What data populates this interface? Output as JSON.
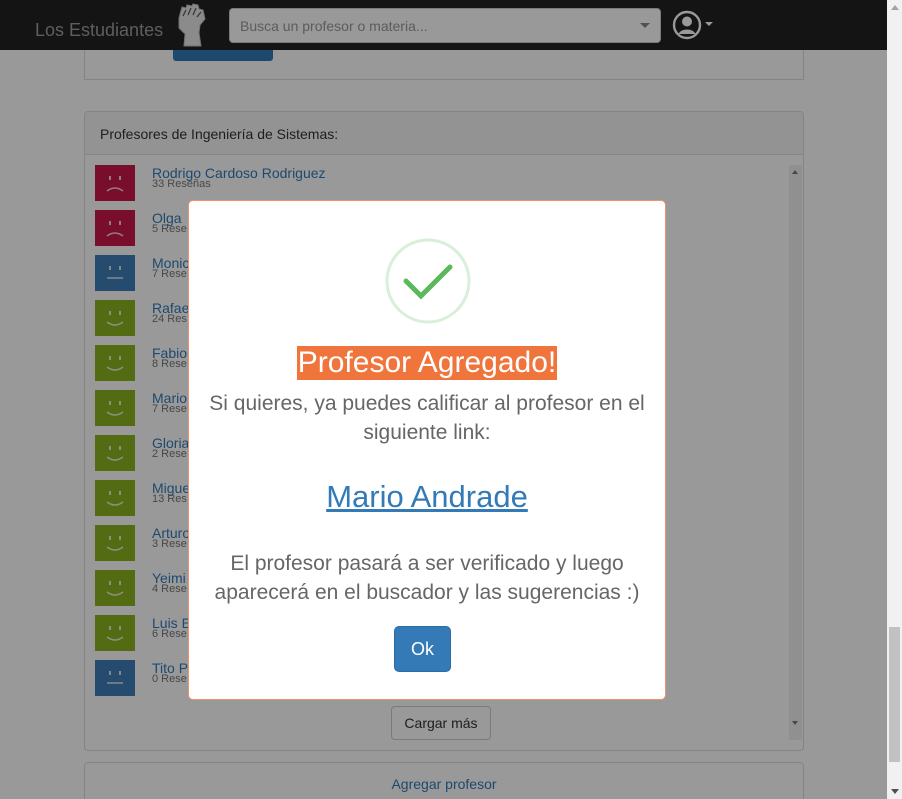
{
  "navbar": {
    "brand": "Los Estudiantes",
    "search_placeholder": "Busca un profesor o materia..."
  },
  "professors_panel": {
    "heading": "Profesores de Ingeniería de Sistemas:",
    "items": [
      {
        "name": "Rodrigo Cardoso Rodriguez",
        "reviews": "33 Reseñas",
        "face": "sad",
        "color": "#c9184a"
      },
      {
        "name": "Olga",
        "reviews": "5 Rese",
        "face": "sad",
        "color": "#c9184a"
      },
      {
        "name": "Monic",
        "reviews": "7 Rese",
        "face": "neutral",
        "color": "#3f7fba"
      },
      {
        "name": "Rafae",
        "reviews": "24 Res",
        "face": "happy",
        "color": "#8ab21f"
      },
      {
        "name": "Fabio",
        "reviews": "8 Rese",
        "face": "happy",
        "color": "#8ab21f"
      },
      {
        "name": "Mario",
        "reviews": "7 Rese",
        "face": "happy",
        "color": "#8ab21f"
      },
      {
        "name": "Gloria",
        "reviews": "2 Rese",
        "face": "happy",
        "color": "#8ab21f"
      },
      {
        "name": "Migue",
        "reviews": "13 Res",
        "face": "happy",
        "color": "#8ab21f"
      },
      {
        "name": "Arturo",
        "reviews": "3 Rese",
        "face": "happy",
        "color": "#8ab21f"
      },
      {
        "name": "Yeimi",
        "reviews": "4 Rese",
        "face": "happy",
        "color": "#8ab21f"
      },
      {
        "name": "Luis E",
        "reviews": "6 Rese",
        "face": "happy",
        "color": "#8ab21f"
      },
      {
        "name": "Tito P",
        "reviews": "0 Rese",
        "face": "neutral",
        "color": "#3f7fba"
      }
    ],
    "load_more": "Cargar más"
  },
  "add_professor": "Agregar profesor",
  "modal": {
    "title": "Profesor Agregado!",
    "text": "Si quieres, ya puedes calificar al profesor en el siguiente link:",
    "link": "Mario Andrade",
    "note": "El profesor pasará a ser verificado y luego aparecerá en el buscador y las sugerencias :)",
    "ok": "Ok",
    "icon": "check-icon",
    "success_color": "#5cb85c"
  }
}
